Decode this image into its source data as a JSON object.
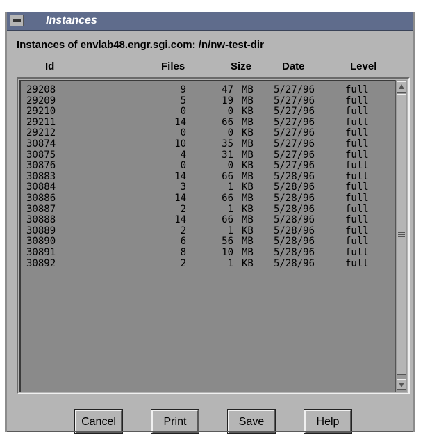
{
  "window": {
    "title": "Instances"
  },
  "header": {
    "label": "Instances of envlab48.engr.sgi.com: /n/nw-test-dir"
  },
  "columns": {
    "id": "Id",
    "files": "Files",
    "size": "Size",
    "date": "Date",
    "level": "Level"
  },
  "rows": [
    {
      "id": "29208",
      "files": "9",
      "size": "47",
      "unit": "MB",
      "date": "5/27/96",
      "level": "full"
    },
    {
      "id": "29209",
      "files": "5",
      "size": "19",
      "unit": "MB",
      "date": "5/27/96",
      "level": "full"
    },
    {
      "id": "29210",
      "files": "0",
      "size": "0",
      "unit": "KB",
      "date": "5/27/96",
      "level": "full"
    },
    {
      "id": "29211",
      "files": "14",
      "size": "66",
      "unit": "MB",
      "date": "5/27/96",
      "level": "full"
    },
    {
      "id": "29212",
      "files": "0",
      "size": "0",
      "unit": "KB",
      "date": "5/27/96",
      "level": "full"
    },
    {
      "id": "30874",
      "files": "10",
      "size": "35",
      "unit": "MB",
      "date": "5/27/96",
      "level": "full"
    },
    {
      "id": "30875",
      "files": "4",
      "size": "31",
      "unit": "MB",
      "date": "5/27/96",
      "level": "full"
    },
    {
      "id": "30876",
      "files": "0",
      "size": "0",
      "unit": "KB",
      "date": "5/27/96",
      "level": "full"
    },
    {
      "id": "30883",
      "files": "14",
      "size": "66",
      "unit": "MB",
      "date": "5/28/96",
      "level": "full"
    },
    {
      "id": "30884",
      "files": "3",
      "size": "1",
      "unit": "KB",
      "date": "5/28/96",
      "level": "full"
    },
    {
      "id": "30886",
      "files": "14",
      "size": "66",
      "unit": "MB",
      "date": "5/28/96",
      "level": "full"
    },
    {
      "id": "30887",
      "files": "2",
      "size": "1",
      "unit": "KB",
      "date": "5/28/96",
      "level": "full"
    },
    {
      "id": "30888",
      "files": "14",
      "size": "66",
      "unit": "MB",
      "date": "5/28/96",
      "level": "full"
    },
    {
      "id": "30889",
      "files": "2",
      "size": "1",
      "unit": "KB",
      "date": "5/28/96",
      "level": "full"
    },
    {
      "id": "30890",
      "files": "6",
      "size": "56",
      "unit": "MB",
      "date": "5/28/96",
      "level": "full"
    },
    {
      "id": "30891",
      "files": "8",
      "size": "10",
      "unit": "MB",
      "date": "5/28/96",
      "level": "full"
    },
    {
      "id": "30892",
      "files": "2",
      "size": "1",
      "unit": "KB",
      "date": "5/28/96",
      "level": "full"
    }
  ],
  "buttons": {
    "cancel": "Cancel",
    "print": "Print",
    "save": "Save",
    "help": "Help"
  },
  "colors": {
    "titlebar": "#5f6c8c",
    "window_bg": "#b5b5b5",
    "list_bg": "#8a8a8a"
  },
  "icons": {
    "window_menu": "window-menu-icon",
    "scroll_up": "scroll-up-arrow-icon",
    "scroll_down": "scroll-down-arrow-icon"
  }
}
